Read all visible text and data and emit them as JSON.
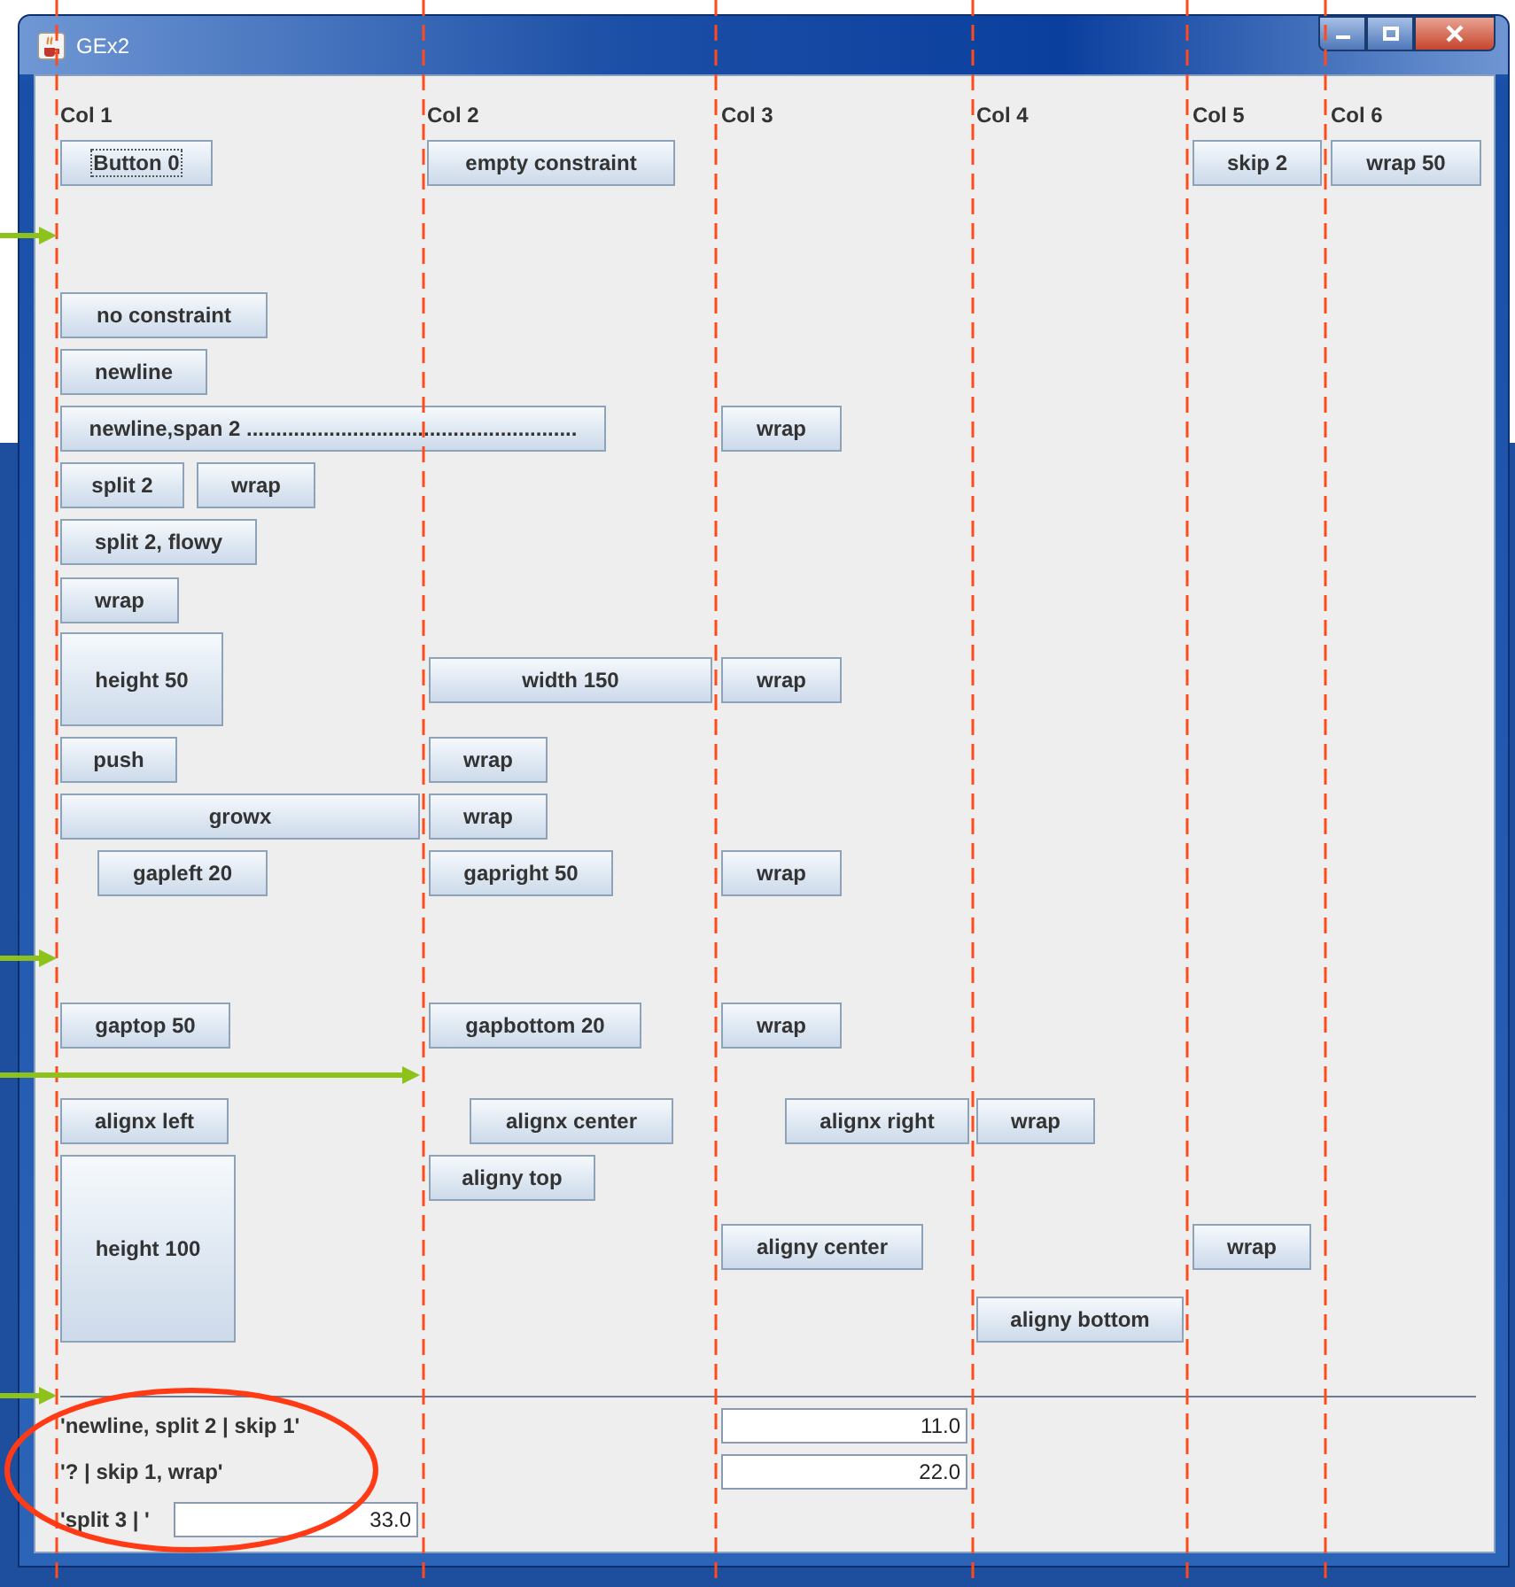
{
  "window": {
    "title": "GEx2"
  },
  "column_headers": [
    "Col 1",
    "Col 2",
    "Col 3",
    "Col 4",
    "Col 5",
    "Col 6"
  ],
  "buttons": [
    {
      "label": "Button 0",
      "focused": true
    },
    {
      "label": "empty constraint",
      "focused": false
    },
    {
      "label": "skip 2",
      "focused": false
    },
    {
      "label": "wrap 50",
      "focused": false
    },
    {
      "label": "no constraint",
      "focused": false
    },
    {
      "label": "newline",
      "focused": false
    },
    {
      "label": "newline,span 2 ........................................................",
      "focused": false
    },
    {
      "label": "wrap",
      "focused": false
    },
    {
      "label": "split 2",
      "focused": false
    },
    {
      "label": "wrap",
      "focused": false
    },
    {
      "label": "split 2, flowy",
      "focused": false
    },
    {
      "label": "wrap",
      "focused": false
    },
    {
      "label": "height 50",
      "focused": false
    },
    {
      "label": "width 150",
      "focused": false
    },
    {
      "label": "wrap",
      "focused": false
    },
    {
      "label": "push",
      "focused": false
    },
    {
      "label": "wrap",
      "focused": false
    },
    {
      "label": "growx",
      "focused": false
    },
    {
      "label": "wrap",
      "focused": false
    },
    {
      "label": "gapleft 20",
      "focused": false
    },
    {
      "label": "gapright 50",
      "focused": false
    },
    {
      "label": "wrap",
      "focused": false
    },
    {
      "label": "gaptop 50",
      "focused": false
    },
    {
      "label": "gapbottom 20",
      "focused": false
    },
    {
      "label": "wrap",
      "focused": false
    },
    {
      "label": "alignx left",
      "focused": false
    },
    {
      "label": "alignx center",
      "focused": false
    },
    {
      "label": "alignx right",
      "focused": false
    },
    {
      "label": "wrap",
      "focused": false
    },
    {
      "label": "aligny top",
      "focused": false
    },
    {
      "label": "height 100",
      "focused": false
    },
    {
      "label": "aligny center",
      "focused": false
    },
    {
      "label": "wrap",
      "focused": false
    },
    {
      "label": "aligny bottom",
      "focused": false
    }
  ],
  "form_rows": [
    {
      "label": "'newline, split 2 | skip 1'",
      "value": "11.0"
    },
    {
      "label": "'? | skip 1, wrap'",
      "value": "22.0"
    },
    {
      "label": "'split 3 | '",
      "value": "33.0"
    }
  ]
}
